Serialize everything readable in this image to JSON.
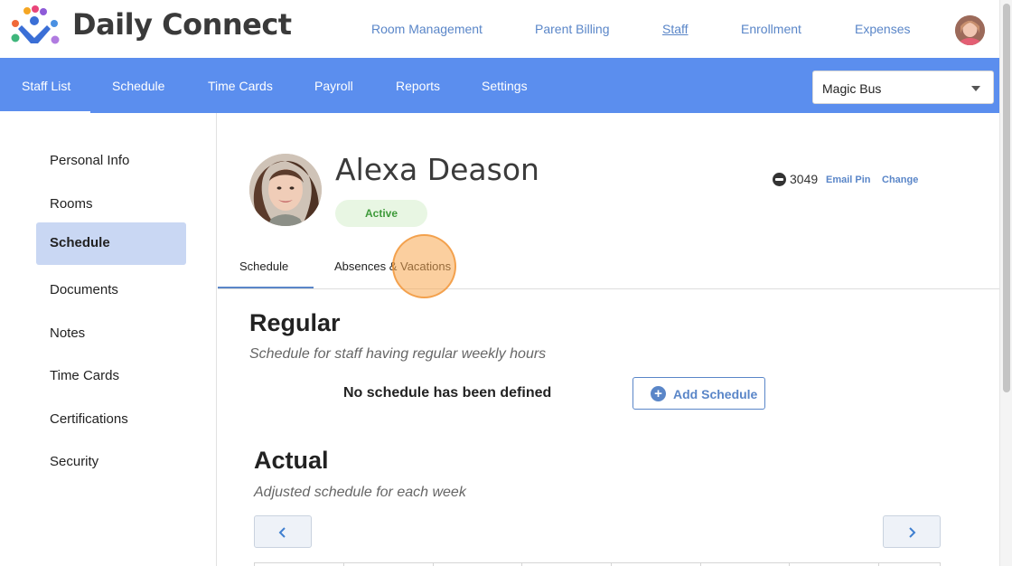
{
  "app": {
    "brand": "Daily Connect",
    "logo_icon": "people-dots-logo",
    "colors": {
      "nav_blue": "#5b8eee",
      "link_blue": "#5a86c8",
      "active_green": "#3e9a3a",
      "active_side": "#c9d7f3"
    }
  },
  "top_nav": {
    "items": [
      {
        "label": "Room Management"
      },
      {
        "label": "Parent Billing"
      },
      {
        "label": "Staff",
        "active": true
      },
      {
        "label": "Enrollment"
      },
      {
        "label": "Expenses"
      }
    ]
  },
  "sub_nav": {
    "items": [
      {
        "label": "Staff List",
        "active": true
      },
      {
        "label": "Schedule"
      },
      {
        "label": "Time Cards"
      },
      {
        "label": "Payroll"
      },
      {
        "label": "Reports"
      },
      {
        "label": "Settings"
      }
    ],
    "school_select": {
      "value": "Magic Bus"
    }
  },
  "sidebar": {
    "items": [
      {
        "label": "Personal Info"
      },
      {
        "label": "Rooms"
      },
      {
        "label": "Schedule",
        "active": true
      },
      {
        "label": "Documents"
      },
      {
        "label": "Notes"
      },
      {
        "label": "Time Cards"
      },
      {
        "label": "Certifications"
      },
      {
        "label": "Security"
      }
    ]
  },
  "profile": {
    "name": "Alexa Deason",
    "status": "Active",
    "pin": "3049",
    "email_pin_label": "Email Pin",
    "change_label": "Change"
  },
  "tabs": [
    {
      "label": "Schedule",
      "active": true
    },
    {
      "label": "Absences & Vacations"
    }
  ],
  "regular": {
    "title": "Regular",
    "subtitle": "Schedule for staff having regular weekly hours",
    "empty_message": "No schedule has been defined",
    "add_button": "Add Schedule"
  },
  "actual": {
    "title": "Actual",
    "subtitle": "Adjusted schedule for each week"
  }
}
